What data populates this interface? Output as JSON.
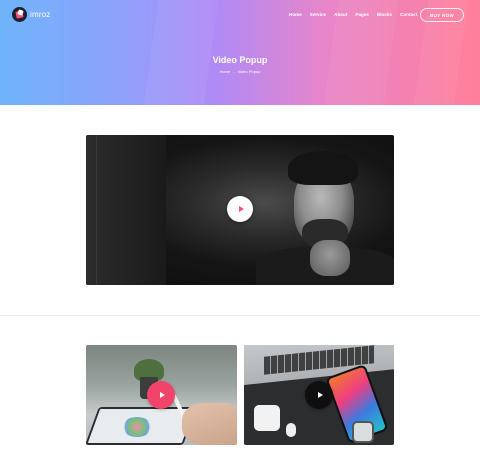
{
  "brand": {
    "name": "imroz"
  },
  "nav": {
    "items": [
      "Home",
      "Service",
      "About",
      "Pages",
      "Blocks",
      "Contact"
    ],
    "cta": "BUY NOW"
  },
  "hero": {
    "title": "Video Popup",
    "breadcrumb": [
      "Home",
      "Video Popup"
    ],
    "separator": "-"
  },
  "colors": {
    "accent_pink": "#ff4f7a",
    "gradient_start": "#6fb4fb",
    "gradient_end": "#ff7f9a"
  },
  "icons": {
    "play": "play-icon"
  }
}
